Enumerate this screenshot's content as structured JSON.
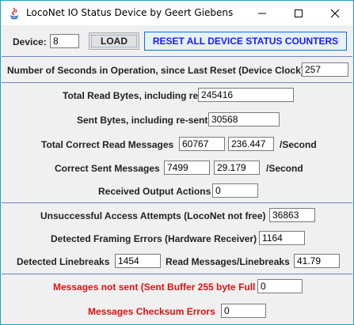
{
  "window": {
    "title": "LocoNet IO Status Device   by Geert Giebens"
  },
  "toolbar": {
    "device_label": "Device:",
    "device_value": "8",
    "load_label": "LOAD",
    "reset_label": "RESET ALL DEVICE STATUS COUNTERS"
  },
  "clock": {
    "label": "Number of Seconds in Operation, since Last Reset (Device Clock)",
    "value": "257"
  },
  "read": {
    "total_bytes_label": "Total Read Bytes, including re-sent",
    "total_bytes_value": "245416",
    "sent_bytes_label": "Sent Bytes, including re-sent",
    "sent_bytes_value": "30568",
    "correct_read_label": "Total Correct Read Messages",
    "correct_read_value": "60767",
    "correct_read_rate": "236.447",
    "correct_read_unit": "/Second",
    "correct_sent_label": "Correct Sent Messages",
    "correct_sent_value": "7499",
    "correct_sent_rate": "29.179",
    "correct_sent_unit": "/Second",
    "output_actions_label": "Received Output Actions",
    "output_actions_value": "0"
  },
  "errors": {
    "unsuccessful_label": "Unsuccessful Access Attempts (LocoNet not free)",
    "unsuccessful_value": "36863",
    "framing_label": "Detected Framing Errors (Hardware Receiver)",
    "framing_value": "1164",
    "linebreaks_label": "Detected Linebreaks",
    "linebreaks_value": "1454",
    "ratio_label": "Read Messages/Linebreaks",
    "ratio_value": "41.79"
  },
  "failures": {
    "not_sent_label": "Messages not sent (Sent Buffer 255 byte Full",
    "not_sent_value": "0",
    "checksum_label": "Messages Checksum Errors",
    "checksum_value": "0"
  },
  "colors": {
    "reset_text": "#1a1aff",
    "error_text": "#e01010",
    "window_border": "#17a0c5",
    "separator": "#6e86b8"
  },
  "icons": [
    "java-app-icon",
    "minimize-icon",
    "maximize-icon",
    "close-icon"
  ]
}
